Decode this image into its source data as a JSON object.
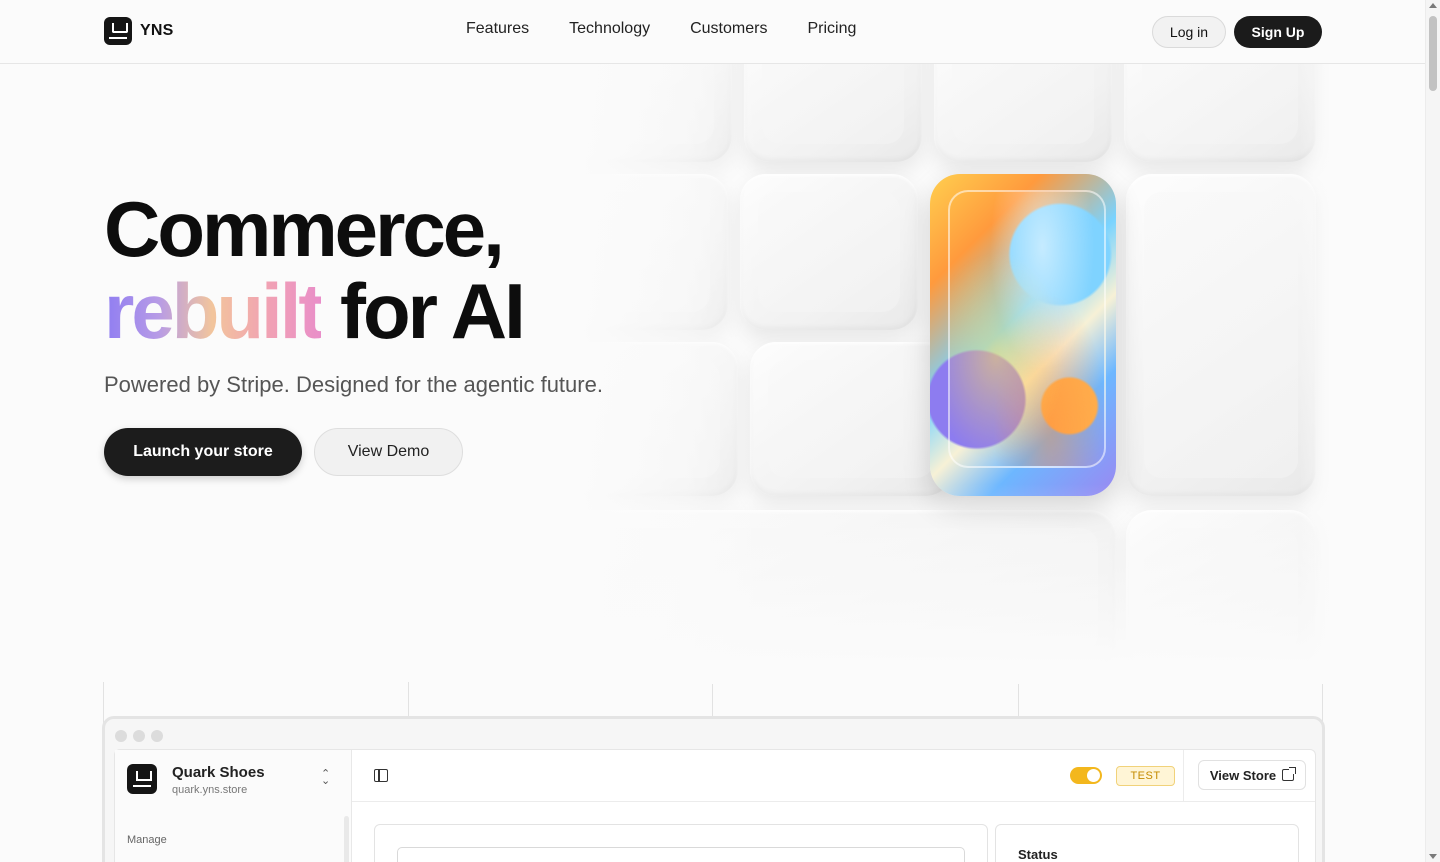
{
  "header": {
    "brand": "YNS",
    "nav": [
      "Features",
      "Technology",
      "Customers",
      "Pricing"
    ],
    "login_label": "Log in",
    "signup_label": "Sign Up"
  },
  "hero": {
    "title_line1": "Commerce,",
    "title_line2_gradient": "rebuilt",
    "title_line2_rest": " for AI",
    "subtitle": "Powered by Stripe. Designed for the agentic future.",
    "cta_primary": "Launch your store",
    "cta_secondary": "View Demo"
  },
  "dashboard": {
    "store_name": "Quark Shoes",
    "store_url": "quark.yns.store",
    "manage_label": "Manage",
    "test_badge": "TEST",
    "view_store_label": "View Store",
    "status_label": "Status",
    "test_mode_enabled": true
  },
  "colors": {
    "primary_dark": "#1b1b1b",
    "toggle_on": "#f3b71d",
    "background": "#fbfbfb"
  },
  "icons": [
    "logo-icon",
    "panel-toggle-icon",
    "external-link-icon",
    "chevron-updown-icon"
  ]
}
